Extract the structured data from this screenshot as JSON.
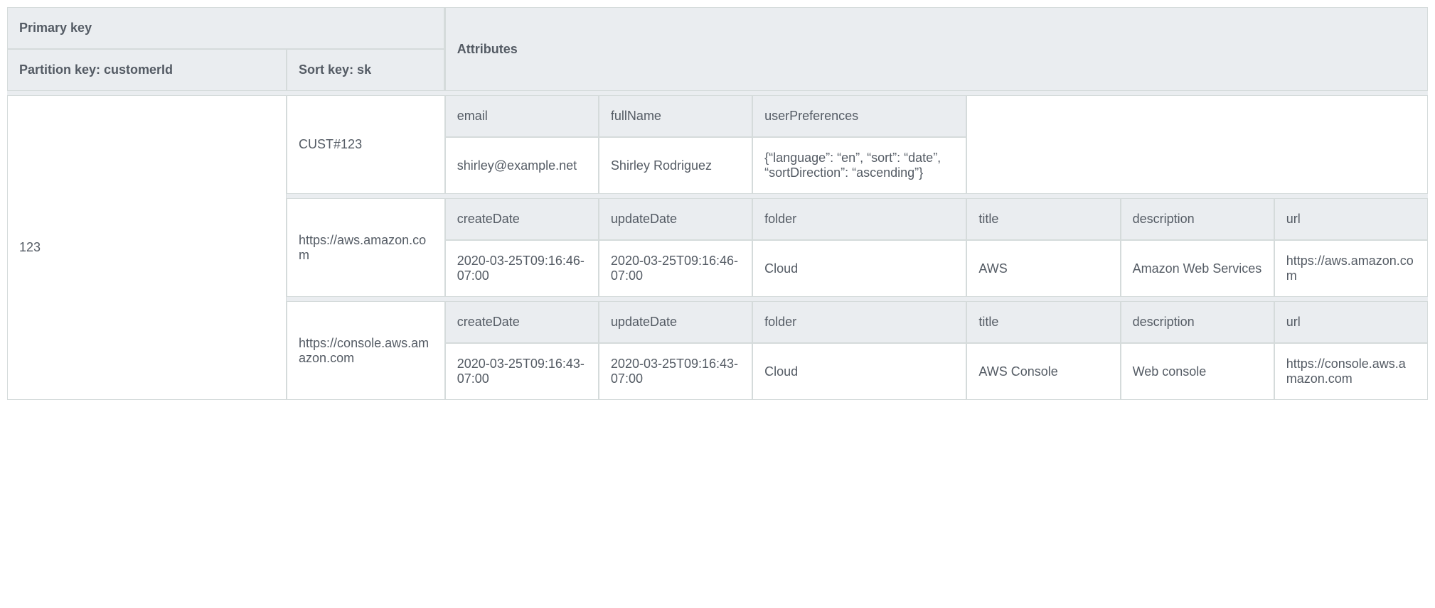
{
  "header": {
    "primary_key": "Primary key",
    "attributes": "Attributes",
    "partition_key": "Partition key: customerId",
    "sort_key": "Sort key: sk"
  },
  "partition_value": "123",
  "items": [
    {
      "sk": "CUST#123",
      "attrs": {
        "h0": "email",
        "v0": "shirley@example.net",
        "h1": "fullName",
        "v1": "Shirley Rodriguez",
        "h2": "userPreferences",
        "v2": "{“language”: “en”, “sort”: “date”, “sortDirection”: “ascending”}"
      }
    },
    {
      "sk": "https://aws.amazon.com",
      "attrs": {
        "h0": "createDate",
        "v0": "2020-03-25T09:16:46-07:00",
        "h1": "updateDate",
        "v1": "2020-03-25T09:16:46-07:00",
        "h2": "folder",
        "v2": "Cloud",
        "h3": "title",
        "v3": "AWS",
        "h4": "description",
        "v4": "Amazon Web Services",
        "h5": "url",
        "v5": "https://aws.amazon.com"
      }
    },
    {
      "sk": "https://console.aws.amazon.com",
      "attrs": {
        "h0": "createDate",
        "v0": "2020-03-25T09:16:43-07:00",
        "h1": "updateDate",
        "v1": "2020-03-25T09:16:43-07:00",
        "h2": "folder",
        "v2": "Cloud",
        "h3": "title",
        "v3": "AWS Console",
        "h4": "description",
        "v4": "Web console",
        "h5": "url",
        "v5": "https://console.aws.amazon.com"
      }
    }
  ]
}
